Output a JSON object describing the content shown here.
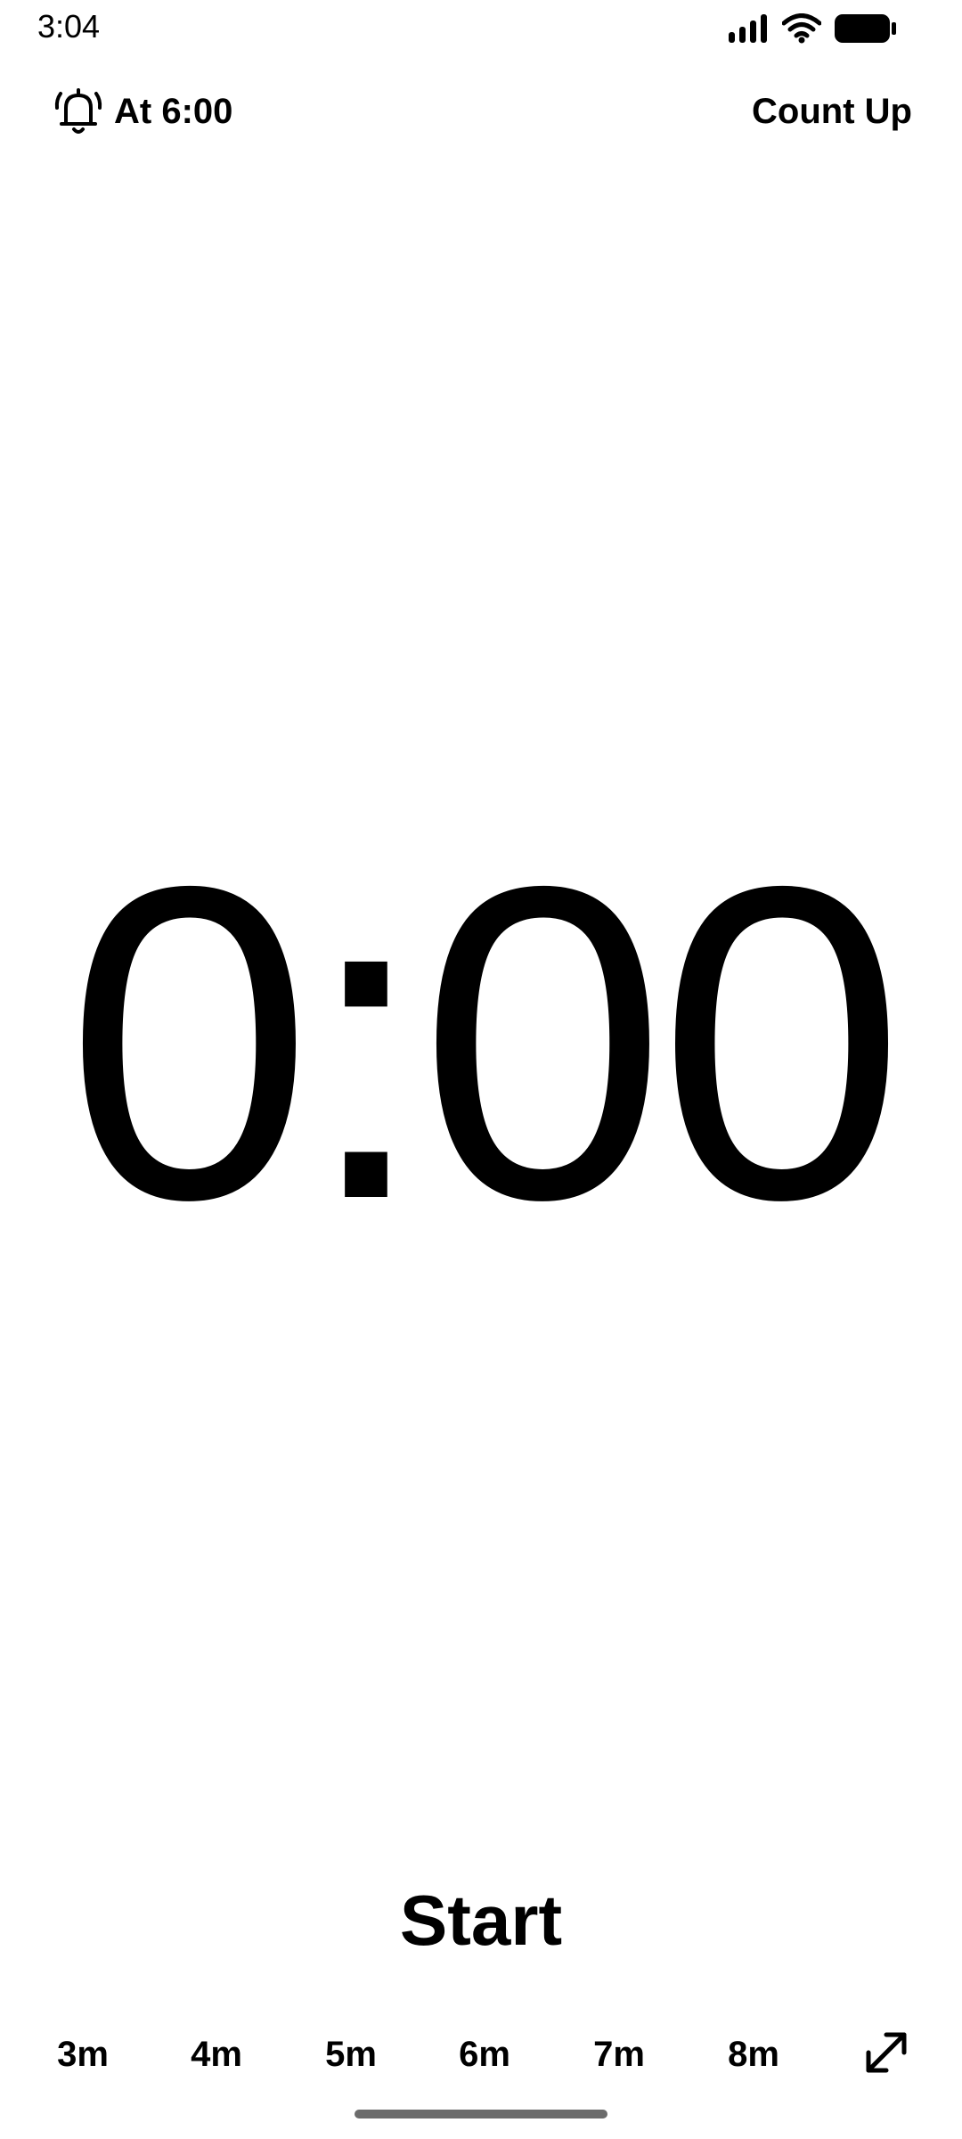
{
  "status_bar": {
    "time": "3:04",
    "icons": [
      "signal-icon",
      "wifi-icon",
      "battery-icon"
    ]
  },
  "top_bar": {
    "alarm_icon": "alarm-bell-icon",
    "alarm_label": "At 6:00",
    "mode_label": "Count Up"
  },
  "timer": {
    "display": "0:00"
  },
  "controls": {
    "start_label": "Start"
  },
  "presets": {
    "items": [
      "3m",
      "4m",
      "5m",
      "6m",
      "7m",
      "8m"
    ],
    "expand_icon": "expand-diagonal-icon"
  },
  "colors": {
    "background": "#ffffff",
    "text": "#000000",
    "home_indicator": "#6b6b6b"
  }
}
